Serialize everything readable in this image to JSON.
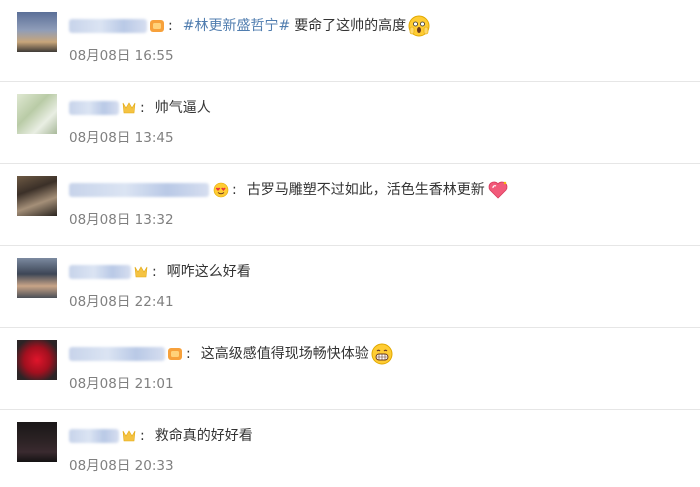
{
  "comments": [
    {
      "hashtag": "#林更新盛哲宁#",
      "text": "要命了这帅的高度",
      "time": "08月08日 16:55",
      "emoji": "scream-face-emoji",
      "badge": "orange-vip-badge"
    },
    {
      "hashtag": "",
      "text": "帅气逼人",
      "time": "08月08日 13:45",
      "emoji": "",
      "badge": "gold-vip-badge"
    },
    {
      "hashtag": "",
      "text": "古罗马雕塑不过如此，活色生香林更新",
      "time": "08月08日 13:32",
      "emoji": "heart-emoji",
      "badge": "heart-eyes-badge"
    },
    {
      "hashtag": "",
      "text": "啊咋这么好看",
      "time": "08月08日 22:41",
      "emoji": "",
      "badge": "gold-vip-badge"
    },
    {
      "hashtag": "",
      "text": "这高级感值得现场畅快体验",
      "time": "08月08日 21:01",
      "emoji": "grin-face-emoji",
      "badge": "orange-vip-badge"
    },
    {
      "hashtag": "",
      "text": "救命真的好好看",
      "time": "08月08日 20:33",
      "emoji": "",
      "badge": "gold-vip-badge"
    }
  ],
  "colors": {
    "link": "#507daf",
    "time": "#808080",
    "divider": "#e6e6e6"
  }
}
